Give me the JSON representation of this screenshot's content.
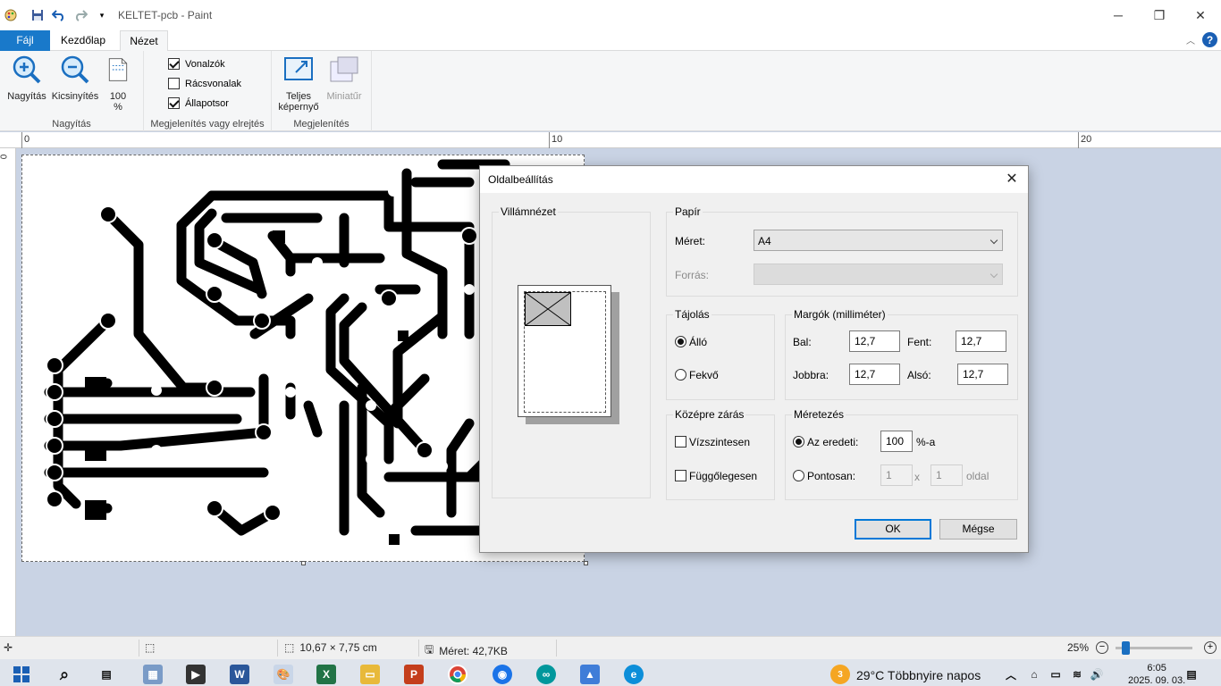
{
  "window": {
    "title": "KELTET-pcb - Paint"
  },
  "tabs": {
    "file": "Fájl",
    "home": "Kezdőlap",
    "view": "Nézet"
  },
  "ribbon": {
    "zoom_in": "Nagyítás",
    "zoom_out": "Kicsinyítés",
    "zoom_100_line1": "100",
    "zoom_100_line2": "%",
    "group_zoom": "Nagyítás",
    "rulers": "Vonalzók",
    "gridlines": "Rácsvonalak",
    "statusbar": "Állapotsor",
    "group_show": "Megjelenítés vagy elrejtés",
    "fullscreen_line1": "Teljes",
    "fullscreen_line2": "képernyő",
    "thumbnail": "Miniatűr",
    "group_display": "Megjelenítés",
    "rulers_checked": true,
    "gridlines_checked": false,
    "statusbar_checked": true
  },
  "ruler": {
    "h0": "0",
    "h10": "10",
    "h20": "20",
    "v0": "0"
  },
  "status": {
    "dimensions": "10,67 × 7,75 cm",
    "size": "Méret: 42,7KB",
    "zoom": "25%",
    "zoom_level": 0.25
  },
  "dialog": {
    "title": "Oldalbeállítás",
    "preview_label": "Villámnézet",
    "paper_label": "Papír",
    "size_label": "Méret:",
    "size_value": "A4",
    "source_label": "Forrás:",
    "orientation_label": "Tájolás",
    "portrait": "Álló",
    "landscape": "Fekvő",
    "margins_label": "Margók (milliméter)",
    "left_label": "Bal:",
    "left_value": "12,7",
    "top_label": "Fent:",
    "top_value": "12,7",
    "right_label": "Jobbra:",
    "right_value": "12,7",
    "bottom_label": "Alsó:",
    "bottom_value": "12,7",
    "center_label": "Középre zárás",
    "horizontal": "Vízszintesen",
    "vertical": "Függőlegesen",
    "scale_label": "Méretezés",
    "adjust_to": "Az eredeti:",
    "adjust_value": "100",
    "adjust_suffix": "%-a",
    "fit_to": "Pontosan:",
    "fit_w": "1",
    "fit_x": "x",
    "fit_h": "1",
    "fit_suffix": "oldal",
    "ok": "OK",
    "cancel": "Mégse"
  },
  "taskbar": {
    "weather_badge": "3",
    "weather": "29°C  Többnyire napos",
    "time": "6:05",
    "date": "2025. 09. 03."
  },
  "colors": {
    "accent": "#1979ca",
    "canvas_bg": "#c9d3e4",
    "dialog_bg": "#f0f0f0"
  }
}
